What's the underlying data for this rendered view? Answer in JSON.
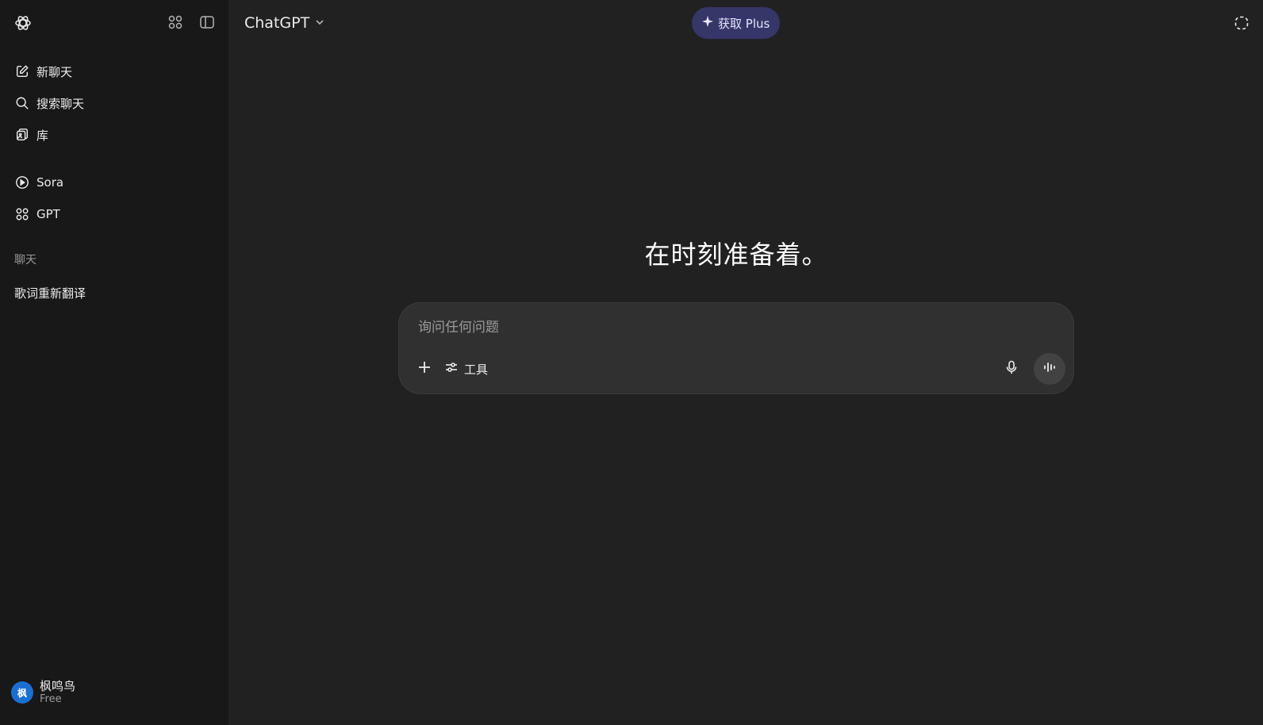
{
  "sidebar": {
    "nav": [
      {
        "label": "新聊天",
        "icon": "edit-icon"
      },
      {
        "label": "搜索聊天",
        "icon": "search-icon"
      },
      {
        "label": "库",
        "icon": "library-icon"
      }
    ],
    "nav2": [
      {
        "label": "Sora",
        "icon": "play-circle-icon"
      },
      {
        "label": "GPT",
        "icon": "grid-icon"
      }
    ],
    "section_label": "聊天",
    "history": [
      {
        "title": "歌词重新翻译"
      }
    ],
    "user": {
      "avatar_letter": "枫",
      "name": "枫鸣鸟",
      "plan": "Free",
      "avatar_color": "#1a6fd1"
    }
  },
  "header": {
    "model": "ChatGPT",
    "plus_label": "获取 Plus",
    "plus_color": "#373669"
  },
  "main": {
    "headline": "在时刻准备着。",
    "composer": {
      "placeholder": "询问任何问题",
      "tools_label": "工具"
    }
  }
}
